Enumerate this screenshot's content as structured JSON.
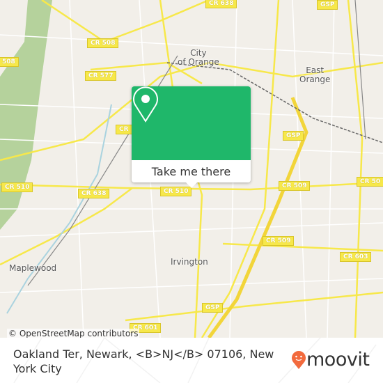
{
  "map": {
    "attribution": "© OpenStreetMap contributors",
    "road_shields": [
      "CR 638",
      "GSP",
      "CR 508",
      "508",
      "CR 577",
      "CR",
      "GSP",
      "CR 510",
      "CR 638",
      "CR 510",
      "CR 509",
      "CR 50",
      "CR 509",
      "CR 603",
      "GSP",
      "CR 601"
    ],
    "places": [
      "City\nof Orange",
      "East\nOrange",
      "Maplewood",
      "Irvington"
    ],
    "colors": {
      "land": "#f2efe9",
      "major_road": "#f7e84a",
      "park": "#b5d29c",
      "water": "#aad3df"
    }
  },
  "popup": {
    "icon": "map-pin-icon",
    "button_label": "Take me there",
    "color": "#1fb76a"
  },
  "footer": {
    "address": "Oakland Ter, Newark, <B>NJ</B> 07106, New York City",
    "logo_text": "moovit",
    "logo_color": "#f26a3d"
  }
}
